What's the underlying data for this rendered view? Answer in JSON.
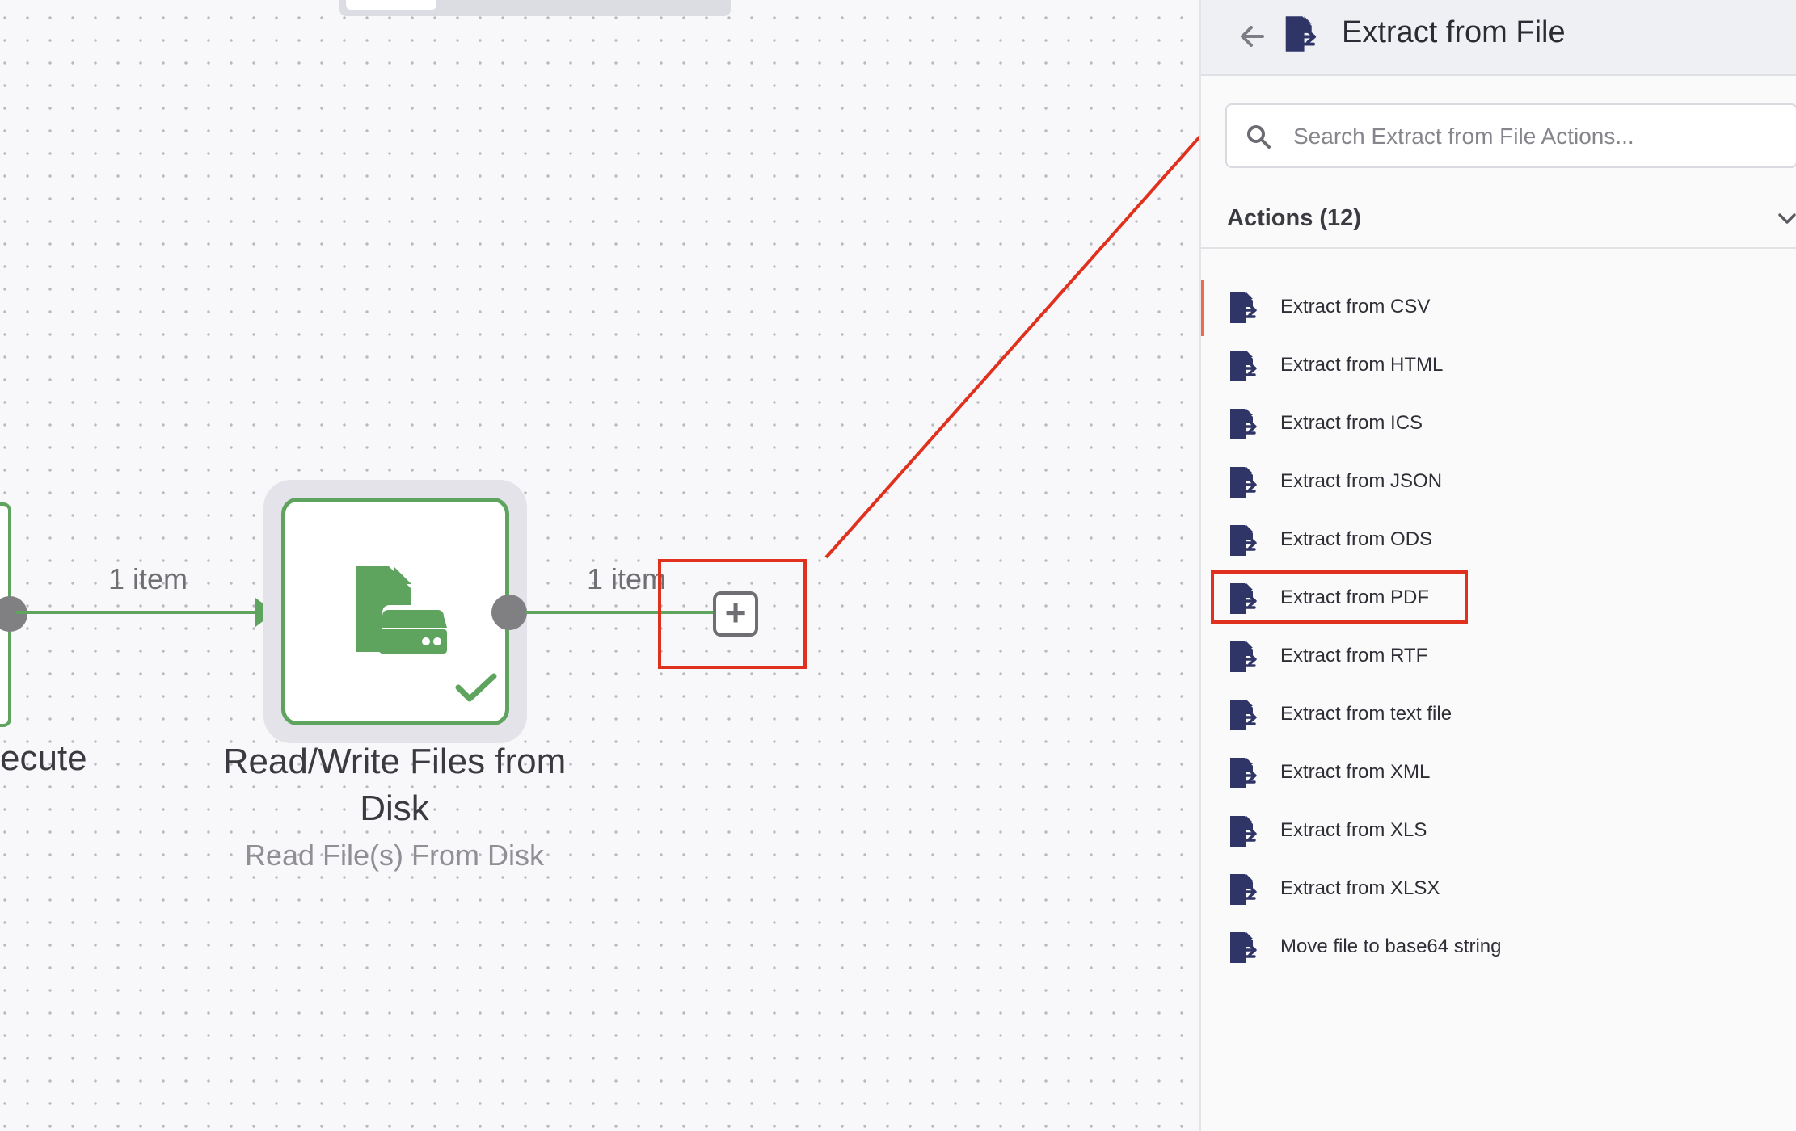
{
  "canvas": {
    "edges": [
      {
        "label": "1 item"
      },
      {
        "label": "1 item"
      }
    ],
    "previous_node": {
      "label_fragment": "ecute"
    },
    "node": {
      "title": "Read/Write Files from Disk",
      "subtitle": "Read File(s) From Disk",
      "status": "success",
      "icon": "file-storage-icon",
      "color": "#5ea35e"
    },
    "add_button": {
      "symbol": "+",
      "icon": "plus-square-icon"
    }
  },
  "panel": {
    "title": "Extract from File",
    "back_icon": "arrow-left-icon",
    "header_icon": "extract-file-icon",
    "search": {
      "placeholder": "Search Extract from File Actions...",
      "value": ""
    },
    "actions_header": "Actions (12)",
    "actions": [
      {
        "label": "Extract from CSV"
      },
      {
        "label": "Extract from HTML"
      },
      {
        "label": "Extract from ICS"
      },
      {
        "label": "Extract from JSON"
      },
      {
        "label": "Extract from ODS"
      },
      {
        "label": "Extract from PDF",
        "is_highlighted": true
      },
      {
        "label": "Extract from RTF"
      },
      {
        "label": "Extract from text file"
      },
      {
        "label": "Extract from XML"
      },
      {
        "label": "Extract from XLS"
      },
      {
        "label": "Extract from XLSX"
      },
      {
        "label": "Move file to base64 string"
      }
    ]
  },
  "colors": {
    "accent_green": "#5ea35e",
    "annotation_red": "#e0301e",
    "icon_navy": "#2f3566",
    "active_indicator": "#ef6a4c"
  }
}
